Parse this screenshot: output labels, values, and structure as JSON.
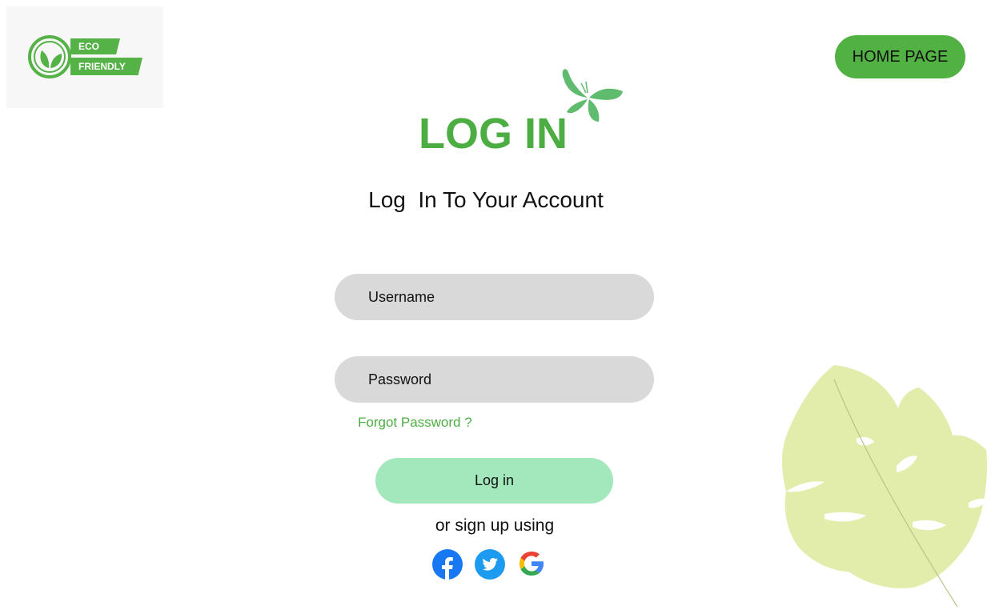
{
  "logo": {
    "eco": "ECO",
    "friendly": "FRIENDLY",
    "icon": "eco-leaf-emblem-icon"
  },
  "header": {
    "home_label": "HOME PAGE"
  },
  "title": "LOG IN",
  "subtitle": "Log  In To Your Account",
  "form": {
    "username_placeholder": "Username",
    "password_placeholder": "Password",
    "forgot_label": "Forgot Password ?",
    "login_label": "Log in"
  },
  "alt_signup": "or sign up using",
  "social": [
    "facebook-icon",
    "twitter-icon",
    "google-icon"
  ],
  "colors": {
    "brand_green": "#4cae42",
    "home_button": "#52b143",
    "input_bg": "#d9d9d9",
    "login_button": "#a3e8bc",
    "leaf": "#e2ecab",
    "butterfly": "#5fbb6e"
  }
}
